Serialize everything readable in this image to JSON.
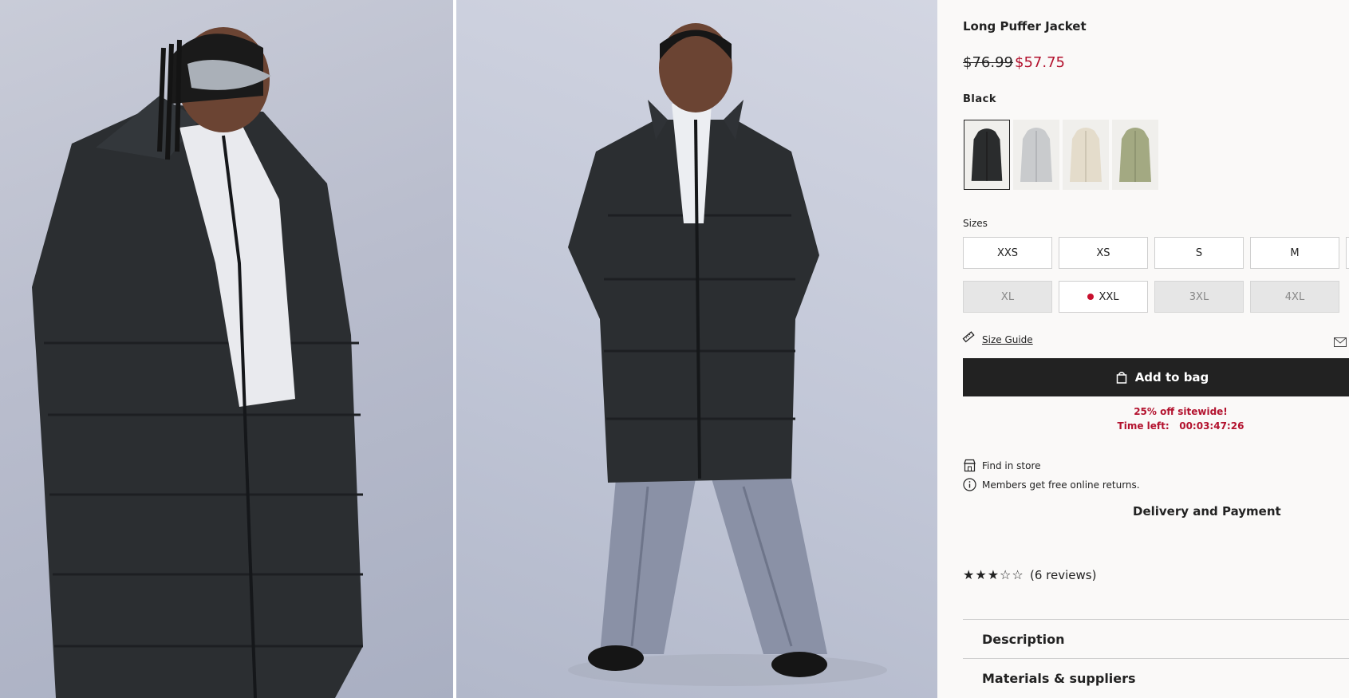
{
  "product": {
    "title": "Long Puffer Jacket",
    "price_original": "$76.99",
    "price_sale": "$57.75",
    "sale_color": "#b3122e"
  },
  "color": {
    "selected_name": "Black",
    "swatches": [
      {
        "name": "black",
        "hex": "#2a2c2d",
        "selected": true
      },
      {
        "name": "light-grey",
        "hex": "#c9cbcd",
        "selected": false
      },
      {
        "name": "cream",
        "hex": "#e4dccb",
        "selected": false
      },
      {
        "name": "sage",
        "hex": "#a3a982",
        "selected": false
      }
    ]
  },
  "sizes": {
    "label": "Sizes",
    "options": [
      {
        "label": "XXS",
        "available": true,
        "low_stock": false
      },
      {
        "label": "XS",
        "available": true,
        "low_stock": false
      },
      {
        "label": "S",
        "available": true,
        "low_stock": false
      },
      {
        "label": "M",
        "available": true,
        "low_stock": false
      },
      {
        "label": "XL",
        "available": false,
        "low_stock": false
      },
      {
        "label": "XXL",
        "available": true,
        "low_stock": true
      },
      {
        "label": "3XL",
        "available": false,
        "low_stock": false
      },
      {
        "label": "4XL",
        "available": false,
        "low_stock": false
      }
    ]
  },
  "size_guide": {
    "label": "Size Guide",
    "icon": "ruler-icon"
  },
  "add_to_bag": {
    "label": "Add to bag",
    "icon": "bag-icon"
  },
  "promo": {
    "line1": "25% off sitewide!",
    "time_label": "Time left:",
    "time_value": "00:03:47:26"
  },
  "info": {
    "find_in_store": "Find in store",
    "returns": "Members get free online returns."
  },
  "delivery_heading": "Delivery and Payment",
  "rating": {
    "stars_filled": 3,
    "stars_total": 5,
    "reviews_text": "(6 reviews)"
  },
  "accordion": {
    "description": "Description",
    "materials": "Materials & suppliers"
  }
}
